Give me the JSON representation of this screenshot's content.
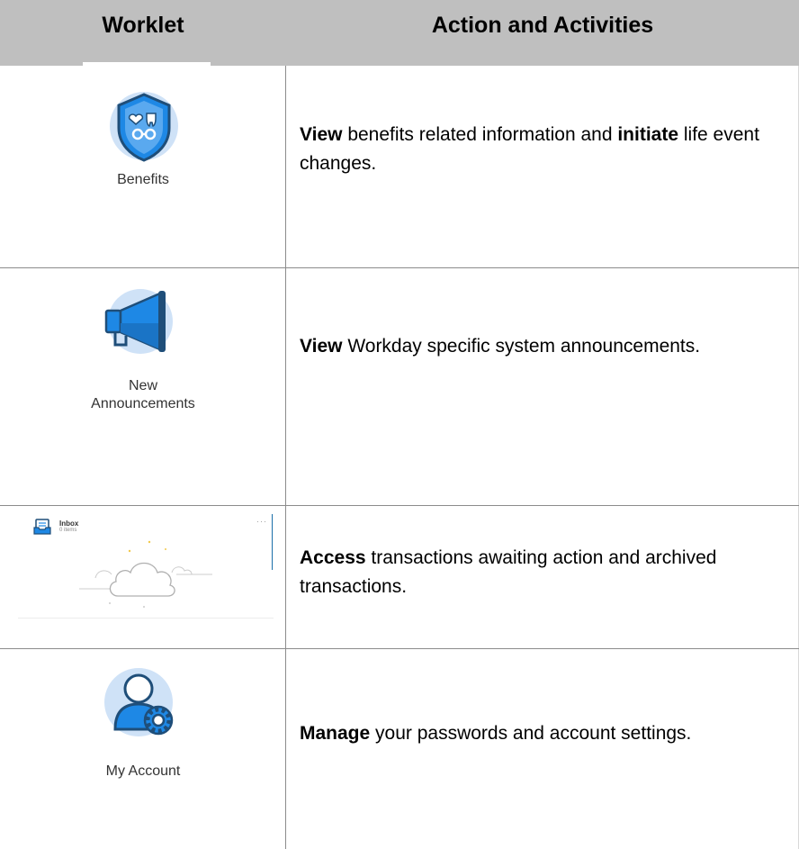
{
  "header": {
    "col1": "Worklet",
    "col2": "Action and Activities"
  },
  "rows": [
    {
      "worklet_label": "Benefits",
      "icon": "benefits-shield-icon",
      "action_bold1": "View",
      "action_text1": " benefits related information and ",
      "action_bold2": "initiate",
      "action_text2": " life event changes."
    },
    {
      "worklet_label_line1": "New",
      "worklet_label_line2": "Announcements",
      "icon": "megaphone-icon",
      "action_bold1": "View",
      "action_text1": " Workday specific system announcements."
    },
    {
      "worklet_title": "Inbox",
      "worklet_subtitle": "0 items",
      "worklet_menu": "···",
      "icon": "inbox-icon",
      "action_bold1": "Access",
      "action_text1": " transactions awaiting action and archived transactions."
    },
    {
      "worklet_label": "My Account",
      "icon": "user-gear-icon",
      "action_bold1": "Manage",
      "action_text1": " your passwords and account settings."
    }
  ],
  "colors": {
    "header_bg": "#bfbfbf",
    "icon_circle": "#cfe2f7",
    "icon_blue": "#1e88e5",
    "icon_dark": "#1f4e79"
  }
}
